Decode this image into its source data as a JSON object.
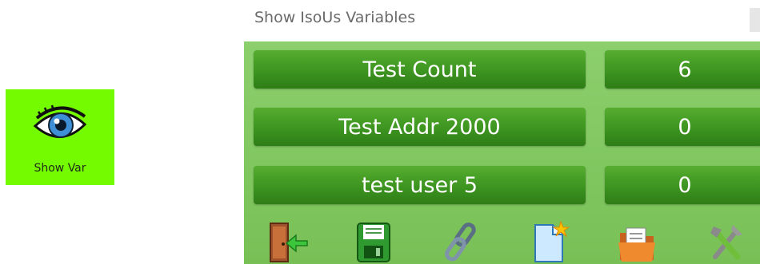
{
  "launcher": {
    "label": "Show Var",
    "icon": "eye-icon",
    "background": "#75fb00"
  },
  "window": {
    "title": "Show IsoUs Variables",
    "panel_color": "#80c860",
    "button_color": "#3d9420"
  },
  "variables": [
    {
      "name": "Test Count",
      "value": "6"
    },
    {
      "name": "Test Addr 2000",
      "value": "0"
    },
    {
      "name": "test user 5",
      "value": "0"
    }
  ],
  "toolbar": [
    {
      "icon": "exit-door-icon"
    },
    {
      "icon": "save-disk-icon"
    },
    {
      "icon": "link-chain-icon"
    },
    {
      "icon": "new-document-icon"
    },
    {
      "icon": "open-folder-icon"
    },
    {
      "icon": "settings-tools-icon"
    }
  ]
}
